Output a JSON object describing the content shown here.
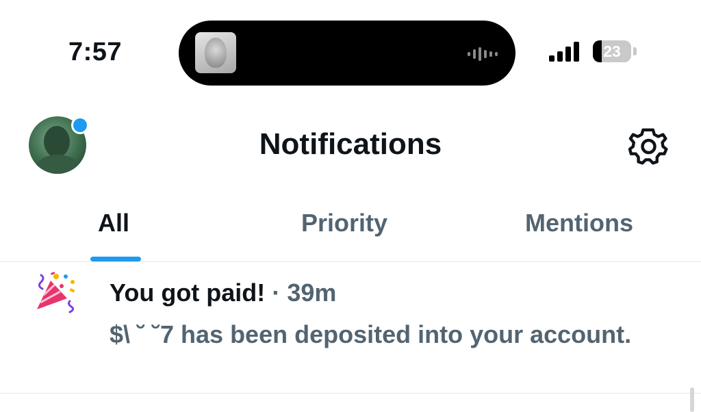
{
  "status_bar": {
    "time": "7:57",
    "battery_percent": "23",
    "battery_level": 0.23,
    "signal_bars": 4
  },
  "header": {
    "title": "Notifications",
    "avatar_badge_color": "#1d9bf0",
    "settings_icon": "gear-icon"
  },
  "tabs": [
    {
      "label": "All",
      "active": true
    },
    {
      "label": "Priority",
      "active": false
    },
    {
      "label": "Mentions",
      "active": false
    }
  ],
  "notification": {
    "icon": "party-popper-icon",
    "title": "You got paid!",
    "separator": "·",
    "time_ago": "39m",
    "body": "$\\ ˘ ˘7 has been deposited into your account."
  },
  "colors": {
    "accent": "#1d9bf0",
    "text_primary": "#0f1419",
    "text_secondary": "#536471"
  }
}
